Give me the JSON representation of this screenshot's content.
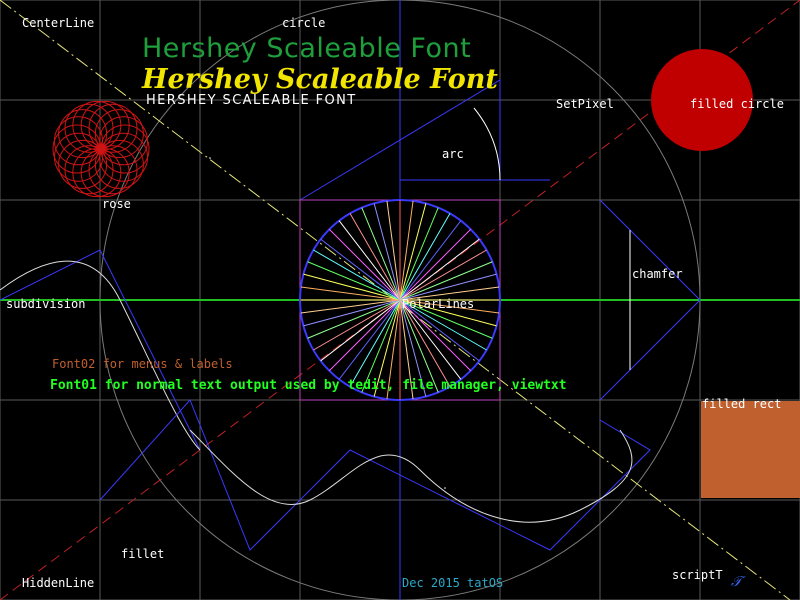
{
  "title_hershey_thin": "Hershey Scaleable Font",
  "title_hershey_gothic": "Hershey Scaleable Font",
  "title_hershey_caps": "HERSHEY SCALEABLE FONT",
  "labels": {
    "centerline": "CenterLine",
    "circle": "circle",
    "setpixel": "SetPixel",
    "filled_circle": "filled circle",
    "arc": "arc",
    "rose": "rose",
    "chamfer": "chamfer",
    "subdivision": "subdivision",
    "polarlines": "PolarLines",
    "filled_rect": "filled rect",
    "fillet": "fillet",
    "hiddenline": "HiddenLine",
    "scriptt": "scriptT",
    "script_glyph": "𝒯"
  },
  "font02_text": "Font02 for menus & labels",
  "font01_text": "Font01 for normal text output used by tedit, file manager, viewtxt",
  "footer": "Dec 2015 tatOS",
  "colors": {
    "background": "#000000",
    "grid": "#5a5a5a",
    "thin_title": "#1f9e3c",
    "gothic_title": "#f2e600",
    "rose": "#d01414",
    "filled_circle": "#c00000",
    "filled_rect": "#c0602e",
    "blue_lines": "#3a3aff",
    "green_line": "#20c020",
    "font01": "#22ff22",
    "font02": "#c0602e",
    "footer": "#2aa8c8",
    "magenta": "#c040c0"
  },
  "icons": {
    "script_t": "script-t-glyph"
  }
}
